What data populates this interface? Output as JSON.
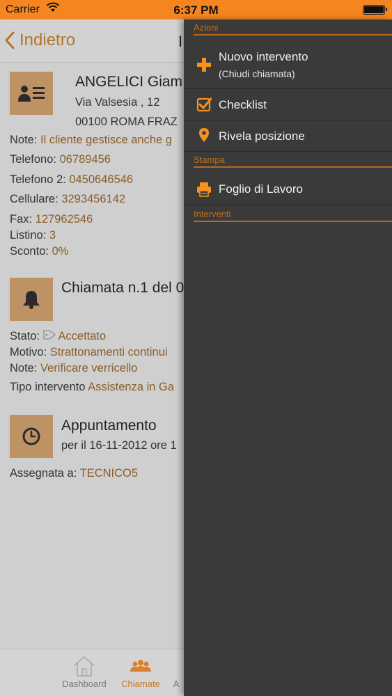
{
  "status_bar": {
    "carrier": "Carrier",
    "time": "6:37 PM"
  },
  "nav": {
    "back_label": "Indietro",
    "title_fragment": "I"
  },
  "customer": {
    "name": "ANGELICI Giam",
    "address": "Via Valsesia , 12",
    "city": "00100  ROMA FRAZ",
    "note_label": "Note:",
    "note_value": "Il cliente gestisce anche g",
    "phone_label": "Telefono:",
    "phone_value": "06789456",
    "phone2_label": "Telefono 2:",
    "phone2_value": "0450646546",
    "mobile_label": "Cellulare:",
    "mobile_value": "3293456142",
    "fax_label": "Fax:",
    "fax_value": "127962546",
    "listino_label": "Listino:",
    "listino_value": "3",
    "sconto_label": "Sconto:",
    "sconto_value": "0%"
  },
  "call": {
    "title": "Chiamata n.1 del 0",
    "stato_label": "Stato:",
    "stato_value": "Accettato",
    "motivo_label": "Motivo:",
    "motivo_value": "Strattonamenti continui",
    "note_label": "Note:",
    "note_value": "Verificare verricello",
    "tipo_label": "Tipo intervento",
    "tipo_value": "Assistenza in Ga"
  },
  "appointment": {
    "title": "Appuntamento",
    "when": "per il 16-11-2012 ore 1",
    "assigned_label": "Assegnata a:",
    "assigned_value": "TECNICO5"
  },
  "tabs": [
    {
      "label": "Dashboard"
    },
    {
      "label": "Chiamate"
    },
    {
      "label": "A"
    }
  ],
  "panel": {
    "sections": {
      "azioni": "Azioni",
      "stampa": "Stampa",
      "interventi": "Interventi"
    },
    "items": {
      "new_intervention": "Nuovo intervento",
      "new_intervention_sub": "(Chiudi chiamata)",
      "checklist": "Checklist",
      "position": "Rivela posizione",
      "worksheet": "Foglio di Lavoro"
    }
  },
  "colors": {
    "accent": "#f5861f",
    "panel_bg": "#3a3a3a",
    "value_text": "#8a5d27"
  }
}
